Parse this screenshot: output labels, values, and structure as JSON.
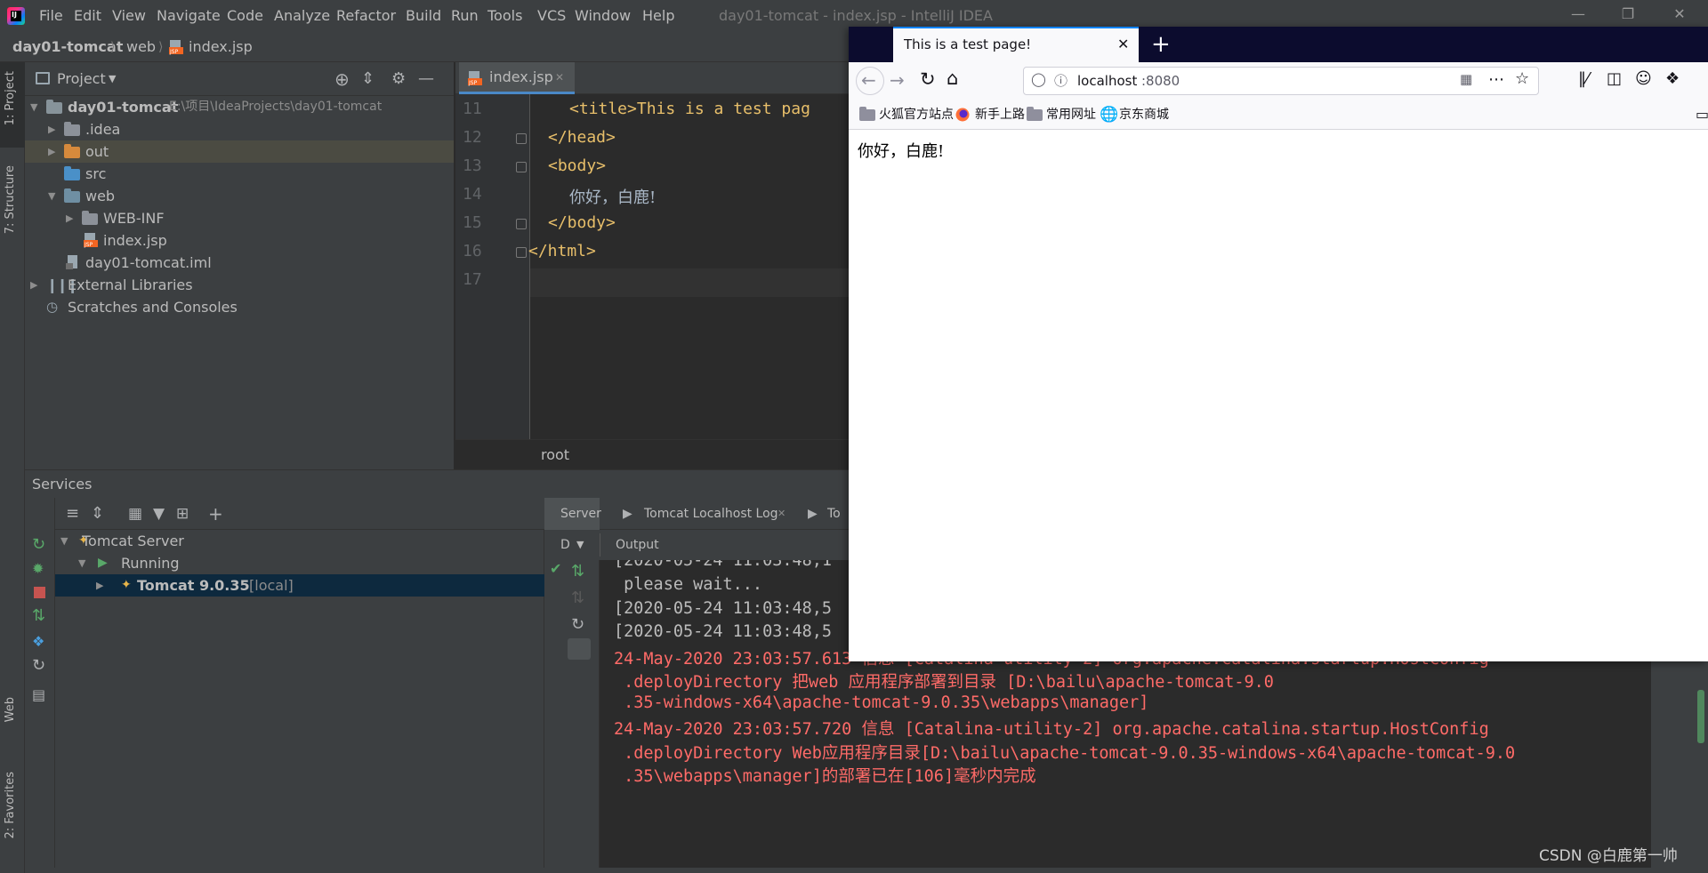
{
  "ide": {
    "window_title": "day01-tomcat - index.jsp - IntelliJ IDEA",
    "menu": [
      "File",
      "Edit",
      "View",
      "Navigate",
      "Code",
      "Analyze",
      "Refactor",
      "Build",
      "Run",
      "Tools",
      "VCS",
      "Window",
      "Help"
    ],
    "breadcrumb": {
      "project": "day01-tomcat",
      "folder": "web",
      "file": "index.jsp"
    },
    "side_tabs": {
      "project": "1: Project",
      "structure": "7: Structure",
      "web": "Web",
      "favorites": "2: Favorites"
    },
    "project_panel": {
      "title": "Project",
      "tree": [
        {
          "label": "day01-tomcat",
          "path": "E:\\项目\\IdeaProjects\\day01-tomcat"
        },
        {
          "label": ".idea"
        },
        {
          "label": "out"
        },
        {
          "label": "src"
        },
        {
          "label": "web"
        },
        {
          "label": "WEB-INF"
        },
        {
          "label": "index.jsp"
        },
        {
          "label": "day01-tomcat.iml"
        },
        {
          "label": "External Libraries"
        },
        {
          "label": "Scratches and Consoles"
        }
      ]
    },
    "editor": {
      "tab_label": "index.jsp",
      "lines": [
        {
          "no": "11",
          "text": "<title>This is a test pag"
        },
        {
          "no": "12",
          "text": "</head>"
        },
        {
          "no": "13",
          "text": "<body>"
        },
        {
          "no": "14",
          "text": "你好，白鹿!"
        },
        {
          "no": "15",
          "text": "</body>"
        },
        {
          "no": "16",
          "text": "</html>"
        },
        {
          "no": "17",
          "text": ""
        }
      ],
      "breadcrumb": "root"
    },
    "services": {
      "title": "Services",
      "tree": [
        {
          "label": "Tomcat Server"
        },
        {
          "label": "Running"
        },
        {
          "label": "Tomcat 9.0.35",
          "suffix": "[local]"
        }
      ],
      "tabs": [
        "Server",
        "Tomcat Localhost Log",
        "To"
      ],
      "deploy_label": "D",
      "output_label": "Output",
      "output_lines": [
        {
          "text": "[2020-05-24 11:03:48,1",
          "color": "grey"
        },
        {
          "text": " please wait...",
          "color": "grey"
        },
        {
          "text": "[2020-05-24 11:03:48,5",
          "color": "grey"
        },
        {
          "text": "[2020-05-24 11:03:48,5",
          "color": "grey"
        },
        {
          "text": "24-May-2020 23:03:57.613 信息 [Catalina-utility-2] org.apache.catalina.startup.HostConfig",
          "color": "red"
        },
        {
          "text": " .deployDirectory 把web 应用程序部署到目录 [D:\\bailu\\apache-tomcat-9.0",
          "color": "red"
        },
        {
          "text": " .35-windows-x64\\apache-tomcat-9.0.35\\webapps\\manager]",
          "color": "red"
        },
        {
          "text": "24-May-2020 23:03:57.720 信息 [Catalina-utility-2] org.apache.catalina.startup.HostConfig",
          "color": "red"
        },
        {
          "text": " .deployDirectory Web应用程序目录[D:\\bailu\\apache-tomcat-9.0.35-windows-x64\\apache-tomcat-9.0",
          "color": "red"
        },
        {
          "text": " .35\\webapps\\manager]的部署已在[106]毫秒内完成",
          "color": "red"
        }
      ]
    }
  },
  "browser": {
    "tab_title": "This is a test page!",
    "url_host": "localhost",
    "url_port": ":8080",
    "bookmarks": [
      "火狐官方站点",
      "新手上路",
      "常用网址",
      "京东商城"
    ],
    "page_text": "你好，白鹿!"
  },
  "watermark": "CSDN @白鹿第一帅",
  "colors": {
    "ide_panel": "#3c3f41",
    "editor_bg": "#2b2b2b",
    "xml_tag": "#e8bf6a",
    "error_text": "#ff6b68",
    "selection": "#0d293e",
    "firefox_tabbar": "#0c0c2e",
    "firefox_accent": "#0a84ff"
  },
  "icons": [
    "intellij-logo",
    "jsp-file-icon",
    "folder-icon",
    "module-folder-icon",
    "tomcat-icon",
    "run-icon",
    "stop-icon",
    "rerun-icon",
    "back-icon",
    "forward-icon",
    "reload-icon",
    "home-icon",
    "star-icon",
    "globe-icon",
    "firefox-icon"
  ]
}
